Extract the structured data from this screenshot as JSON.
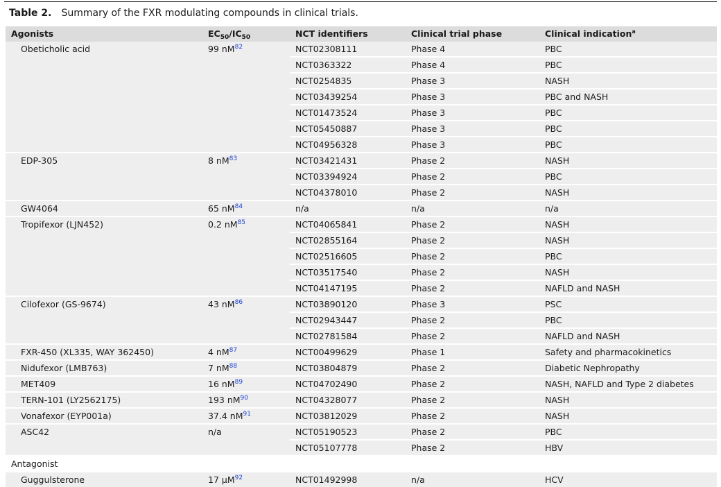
{
  "caption": {
    "label": "Table 2.",
    "text": "Summary of the FXR modulating compounds in clinical trials."
  },
  "headers": {
    "agonists": "Agonists",
    "ec_main": "EC",
    "ec_sub": "50",
    "ic_main": "/IC",
    "ic_sub": "50",
    "nct": "NCT identifiers",
    "phase": "Clinical trial phase",
    "indication": "Clinical indication",
    "indication_note": "a"
  },
  "agonist_groups": [
    {
      "name": "Obeticholic acid",
      "value": "99 nM",
      "ref": "82",
      "trials": [
        {
          "nct": "NCT02308111",
          "phase": "Phase 4",
          "indication": "PBC"
        },
        {
          "nct": "NCT0363322",
          "phase": "Phase 4",
          "indication": "PBC"
        },
        {
          "nct": "NCT0254835",
          "phase": "Phase 3",
          "indication": "NASH"
        },
        {
          "nct": "NCT03439254",
          "phase": "Phase 3",
          "indication": "PBC and NASH"
        },
        {
          "nct": "NCT01473524",
          "phase": "Phase 3",
          "indication": "PBC"
        },
        {
          "nct": "NCT05450887",
          "phase": "Phase 3",
          "indication": "PBC"
        },
        {
          "nct": "NCT04956328",
          "phase": "Phase 3",
          "indication": "PBC"
        }
      ]
    },
    {
      "name": "EDP-305",
      "value": "8 nM",
      "ref": "83",
      "trials": [
        {
          "nct": "NCT03421431",
          "phase": "Phase 2",
          "indication": "NASH"
        },
        {
          "nct": "NCT03394924",
          "phase": "Phase 2",
          "indication": "PBC"
        },
        {
          "nct": "NCT04378010",
          "phase": "Phase 2",
          "indication": "NASH"
        }
      ]
    },
    {
      "name": "GW4064",
      "value": "65 nM",
      "ref": "84",
      "trials": [
        {
          "nct": "n/a",
          "phase": "n/a",
          "indication": "n/a"
        }
      ]
    },
    {
      "name": "Tropifexor (LJN452)",
      "value": "0.2 nM",
      "ref": "85",
      "trials": [
        {
          "nct": "NCT04065841",
          "phase": "Phase 2",
          "indication": "NASH"
        },
        {
          "nct": "NCT02855164",
          "phase": "Phase 2",
          "indication": "NASH"
        },
        {
          "nct": "NCT02516605",
          "phase": "Phase 2",
          "indication": "PBC"
        },
        {
          "nct": "NCT03517540",
          "phase": "Phase 2",
          "indication": "NASH"
        },
        {
          "nct": "NCT04147195",
          "phase": "Phase 2",
          "indication": "NAFLD and NASH"
        }
      ]
    },
    {
      "name": "Cilofexor (GS-9674)",
      "value": "43 nM",
      "ref": "86",
      "trials": [
        {
          "nct": "NCT03890120",
          "phase": "Phase 3",
          "indication": "PSC"
        },
        {
          "nct": "NCT02943447",
          "phase": "Phase 2",
          "indication": "PBC"
        },
        {
          "nct": "NCT02781584",
          "phase": "Phase 2",
          "indication": "NAFLD and NASH"
        }
      ]
    },
    {
      "name": "FXR-450 (XL335, WAY 362450)",
      "value": "4 nM",
      "ref": "87",
      "trials": [
        {
          "nct": "NCT00499629",
          "phase": "Phase 1",
          "indication": "Safety and pharmacokinetics"
        }
      ]
    },
    {
      "name": "Nidufexor (LMB763)",
      "value": "7 nM",
      "ref": "88",
      "trials": [
        {
          "nct": "NCT03804879",
          "phase": "Phase 2",
          "indication": "Diabetic Nephropathy"
        }
      ]
    },
    {
      "name": "MET409",
      "value": "16 nM",
      "ref": "89",
      "trials": [
        {
          "nct": "NCT04702490",
          "phase": "Phase 2",
          "indication": "NASH, NAFLD and Type 2 diabetes"
        }
      ]
    },
    {
      "name": "TERN-101 (LY2562175)",
      "value": "193 nM",
      "ref": "90",
      "trials": [
        {
          "nct": "NCT04328077",
          "phase": "Phase 2",
          "indication": "NASH"
        }
      ]
    },
    {
      "name": "Vonafexor (EYP001a)",
      "value": "37.4 nM",
      "ref": "91",
      "trials": [
        {
          "nct": "NCT03812029",
          "phase": "Phase 2",
          "indication": "NASH"
        }
      ]
    },
    {
      "name": "ASC42",
      "value": "n/a",
      "ref": "",
      "trials": [
        {
          "nct": "NCT05190523",
          "phase": "Phase 2",
          "indication": "PBC"
        },
        {
          "nct": "NCT05107778",
          "phase": "Phase 2",
          "indication": "HBV"
        }
      ]
    }
  ],
  "antagonist_label": "Antagonist",
  "antagonist_groups": [
    {
      "name": "Guggulsterone",
      "value": "17 μM",
      "ref": "92",
      "trials": [
        {
          "nct": "NCT01492998",
          "phase": "n/a",
          "indication": "HCV"
        }
      ]
    }
  ]
}
